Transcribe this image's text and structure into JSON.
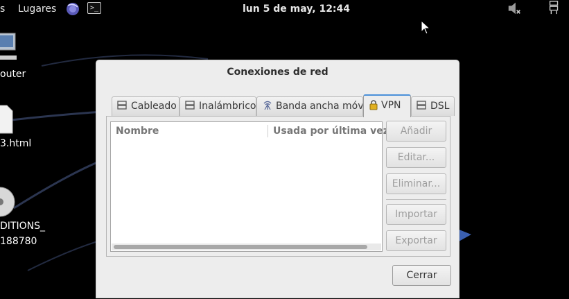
{
  "topbar": {
    "partial_left": "s",
    "places": "Lugares",
    "clock": "lun  5 de may, 12:44",
    "terminal_glyph": ">_"
  },
  "desktop": {
    "icon1_label": "outer",
    "icon2_label": "3.html",
    "icon3_label_line1": "DITIONS_",
    "icon3_label_line2": "188780"
  },
  "dialog": {
    "title": "Conexiones de red",
    "tabs": [
      {
        "label": "Cableado",
        "icon": "wired-icon"
      },
      {
        "label": "Inalámbrico",
        "icon": "wireless-icon"
      },
      {
        "label": "Banda ancha móvil",
        "icon": "mobile-broadband-icon"
      },
      {
        "label": "VPN",
        "icon": "vpn-lock-icon",
        "active": true
      },
      {
        "label": "DSL",
        "icon": "dsl-icon"
      }
    ],
    "columns": [
      "Nombre",
      "Usada por última vez"
    ],
    "buttons": {
      "add": "Añadir",
      "edit": "Editar...",
      "delete": "Eliminar...",
      "import": "Importar",
      "export": "Exportar",
      "close": "Cerrar"
    }
  },
  "colors": {
    "desktop_bg": "#000000",
    "dialog_bg": "#ededed",
    "active_tab_accent": "#4a90d9"
  }
}
